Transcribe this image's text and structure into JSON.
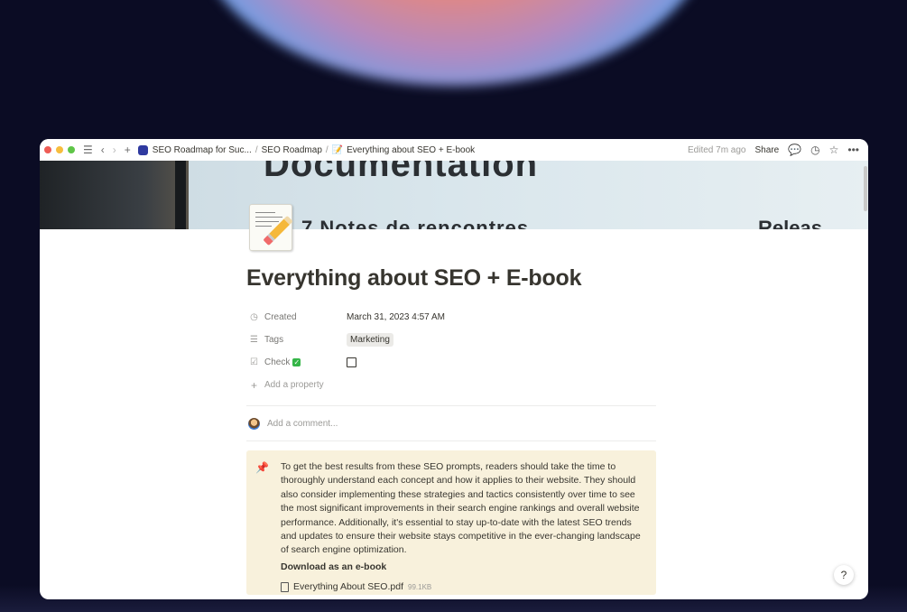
{
  "titlebar": {
    "breadcrumbs": [
      "SEO Roadmap for Suc...",
      "SEO Roadmap",
      "Everything about SEO + E-book"
    ],
    "separator": "/",
    "edited": "Edited 7m ago",
    "share_label": "Share",
    "traffic_colors": [
      "#ee5c55",
      "#f7bd3d",
      "#5fc548"
    ]
  },
  "cover": {
    "text_top": "Documentation",
    "text_left": "7 Notes de rencontres",
    "text_right": "Releas"
  },
  "page": {
    "title": "Everything about SEO + E-book",
    "properties": [
      {
        "icon": "clock-icon",
        "name": "Created",
        "value": "March 31, 2023 4:57 AM"
      },
      {
        "icon": "list-icon",
        "name": "Tags",
        "value": "Marketing"
      },
      {
        "icon": "checkbox-icon",
        "name": "Check",
        "value": ""
      }
    ],
    "add_property": "Add a property",
    "comment_placeholder": "Add a comment...",
    "callout": {
      "icon": "pushpin-icon",
      "text": "To get the best results from these SEO prompts, readers should take the time to thoroughly understand each concept and how it applies to their website. They should also consider implementing these strategies and tactics consistently over time to see the most significant improvements in their search engine rankings and overall website performance. Additionally, it's essential to stay up-to-date with the latest SEO trends and updates to ensure their website stays competitive in the ever-changing landscape of search engine optimization.",
      "download_heading": "Download as an e-book",
      "file_name": "Everything About SEO.pdf",
      "file_size": "99.1KB"
    }
  },
  "help_label": "?"
}
